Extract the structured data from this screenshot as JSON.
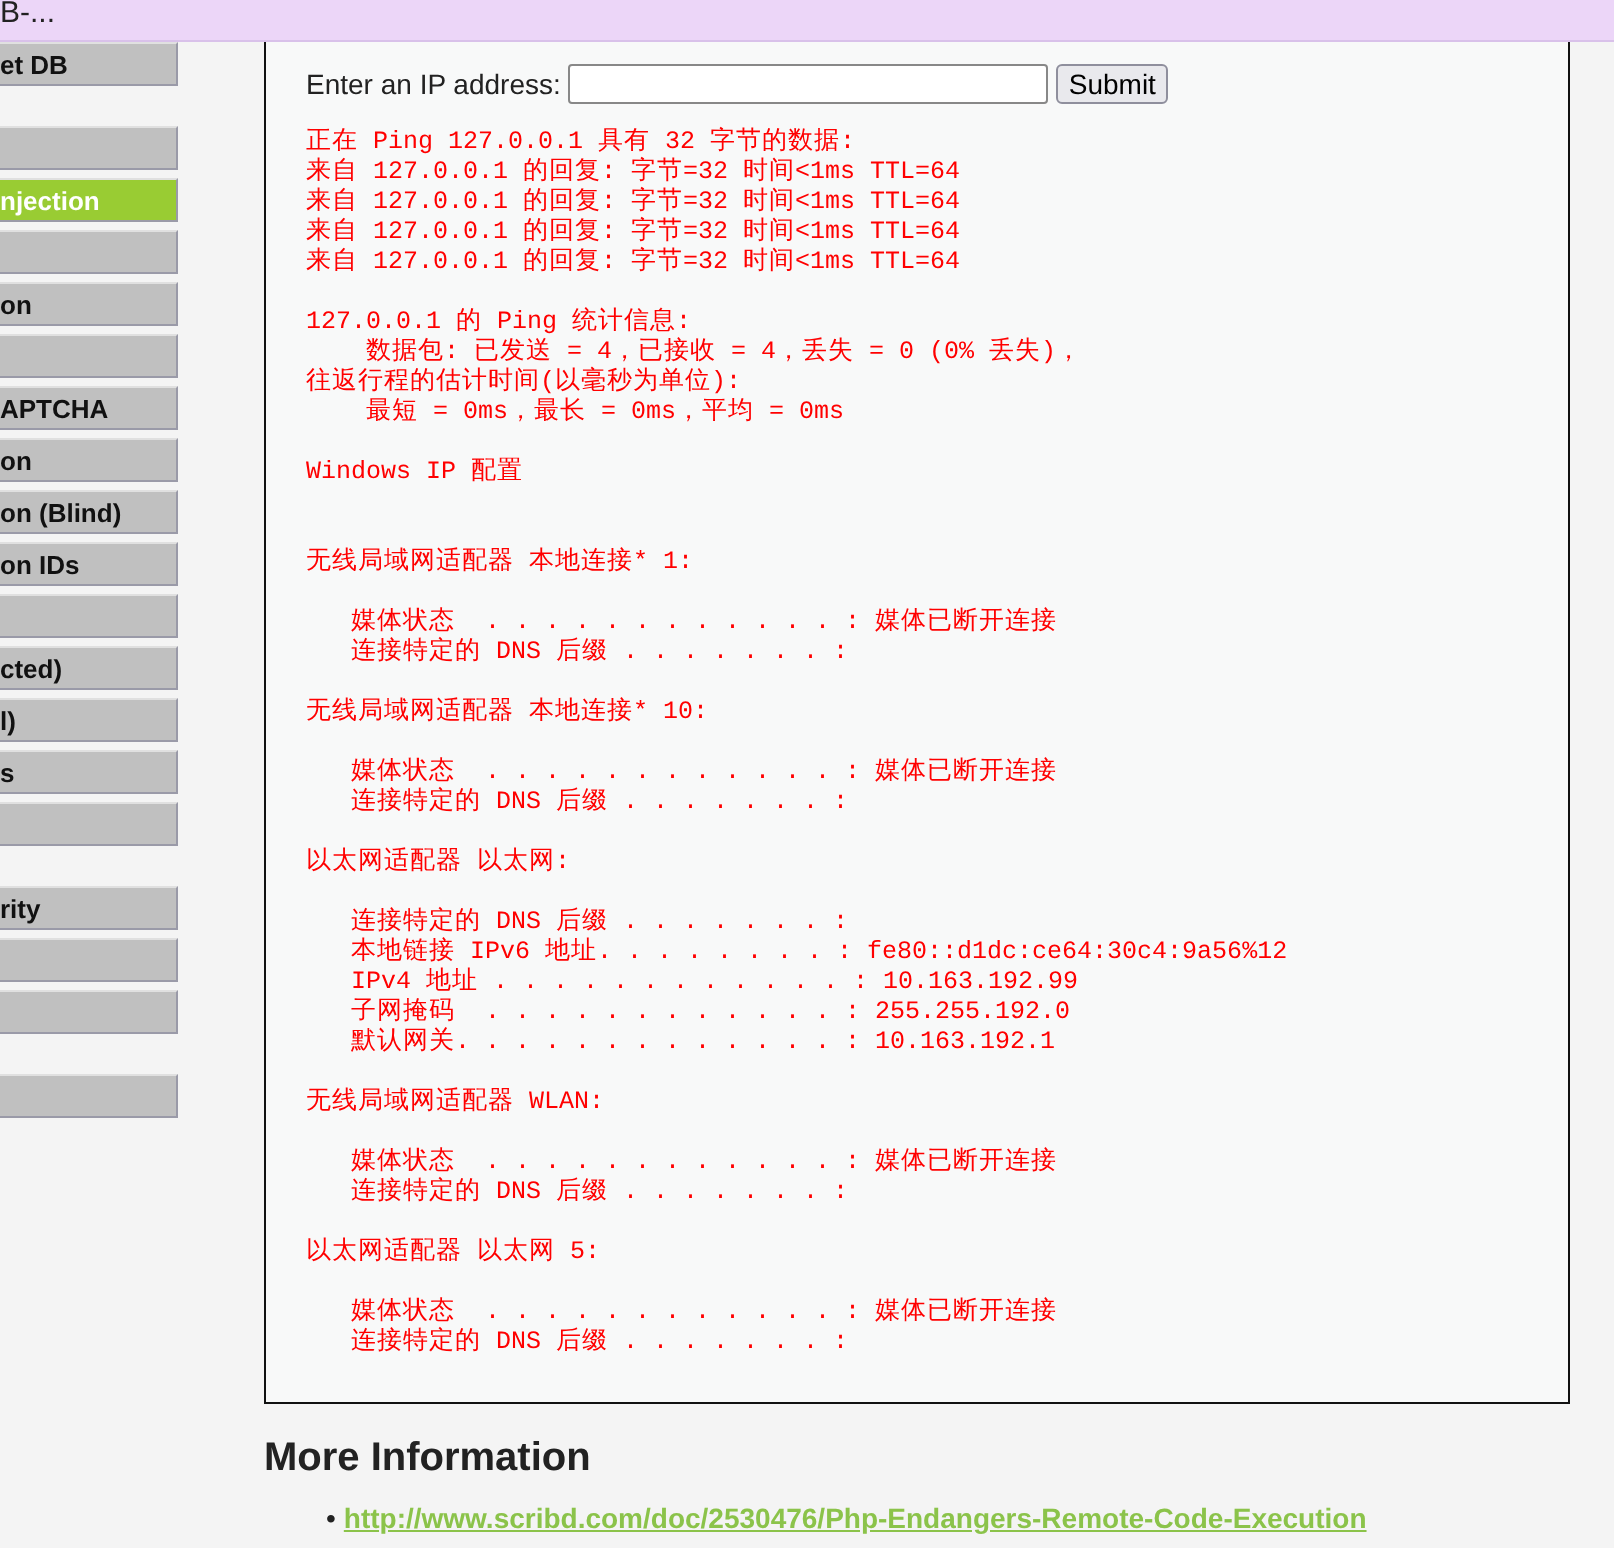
{
  "header": {
    "title": "B-..."
  },
  "sidebar": {
    "groups": [
      {
        "items": [
          {
            "label": "et DB",
            "selected": false
          }
        ]
      },
      {
        "items": [
          {
            "selected": false
          },
          {
            "label": "njection",
            "selected": true
          },
          {
            "selected": false
          },
          {
            "label": "on",
            "selected": false
          },
          {
            "selected": false
          },
          {
            "label": "APTCHA",
            "selected": false
          },
          {
            "label": "on",
            "selected": false
          },
          {
            "label": "on (Blind)",
            "selected": false
          },
          {
            "label": "on IDs",
            "selected": false
          },
          {
            "selected": false
          },
          {
            "label": "cted)",
            "selected": false
          },
          {
            "label": "l)",
            "selected": false
          },
          {
            "label": "s",
            "selected": false
          },
          {
            "selected": false
          }
        ]
      },
      {
        "items": [
          {
            "label": "rity",
            "selected": false
          },
          {
            "selected": false
          },
          {
            "selected": false
          }
        ]
      },
      {
        "items": [
          {
            "selected": false
          }
        ]
      }
    ]
  },
  "form": {
    "label": "Enter an IP address:",
    "button": "Submit"
  },
  "output_blocks": [
    {
      "kind": "section",
      "lines": [
        "正在 Ping 127.0.0.1 具有 32 字节的数据:",
        "来自 127.0.0.1 的回复: 字节=32 时间<1ms TTL=64",
        "来自 127.0.0.1 的回复: 字节=32 时间<1ms TTL=64",
        "来自 127.0.0.1 的回复: 字节=32 时间<1ms TTL=64",
        "来自 127.0.0.1 的回复: 字节=32 时间<1ms TTL=64"
      ]
    },
    {
      "kind": "section",
      "lines": [
        "127.0.0.1 的 Ping 统计信息:",
        "    数据包: 已发送 = 4，已接收 = 4，丢失 = 0 (0% 丢失)，",
        "往返行程的估计时间(以毫秒为单位):",
        "    最短 = 0ms，最长 = 0ms，平均 = 0ms"
      ]
    },
    {
      "kind": "title",
      "lines": [
        "Windows IP 配置"
      ]
    },
    {
      "kind": "section",
      "lines": [
        "无线局域网适配器 本地连接* 1:"
      ]
    },
    {
      "kind": "section",
      "lines": [
        "   媒体状态  . . . . . . . . . . . . : 媒体已断开连接",
        "   连接特定的 DNS 后缀 . . . . . . . :"
      ]
    },
    {
      "kind": "section",
      "lines": [
        "无线局域网适配器 本地连接* 10:"
      ]
    },
    {
      "kind": "section",
      "lines": [
        "   媒体状态  . . . . . . . . . . . . : 媒体已断开连接",
        "   连接特定的 DNS 后缀 . . . . . . . :"
      ]
    },
    {
      "kind": "section",
      "lines": [
        "以太网适配器 以太网:"
      ]
    },
    {
      "kind": "section",
      "lines": [
        "   连接特定的 DNS 后缀 . . . . . . . :",
        "   本地链接 IPv6 地址. . . . . . . . : fe80::d1dc:ce64:30c4:9a56%12",
        "   IPv4 地址 . . . . . . . . . . . . : 10.163.192.99",
        "   子网掩码  . . . . . . . . . . . . : 255.255.192.0",
        "   默认网关. . . . . . . . . . . . . : 10.163.192.1"
      ]
    },
    {
      "kind": "section",
      "lines": [
        "无线局域网适配器 WLAN:"
      ]
    },
    {
      "kind": "section",
      "lines": [
        "   媒体状态  . . . . . . . . . . . . : 媒体已断开连接",
        "   连接特定的 DNS 后缀 . . . . . . . :"
      ]
    },
    {
      "kind": "section",
      "lines": [
        "以太网适配器 以太网 5:"
      ]
    },
    {
      "kind": "section",
      "lines": [
        "   媒体状态  . . . . . . . . . . . . : 媒体已断开连接",
        "   连接特定的 DNS 后缀 . . . . . . . :"
      ]
    }
  ],
  "more_info": {
    "heading": "More Information",
    "links": [
      {
        "bullet": "•",
        "text": "http://www.scribd.com/doc/2530476/Php-Endangers-Remote-Code-Execution"
      }
    ]
  }
}
